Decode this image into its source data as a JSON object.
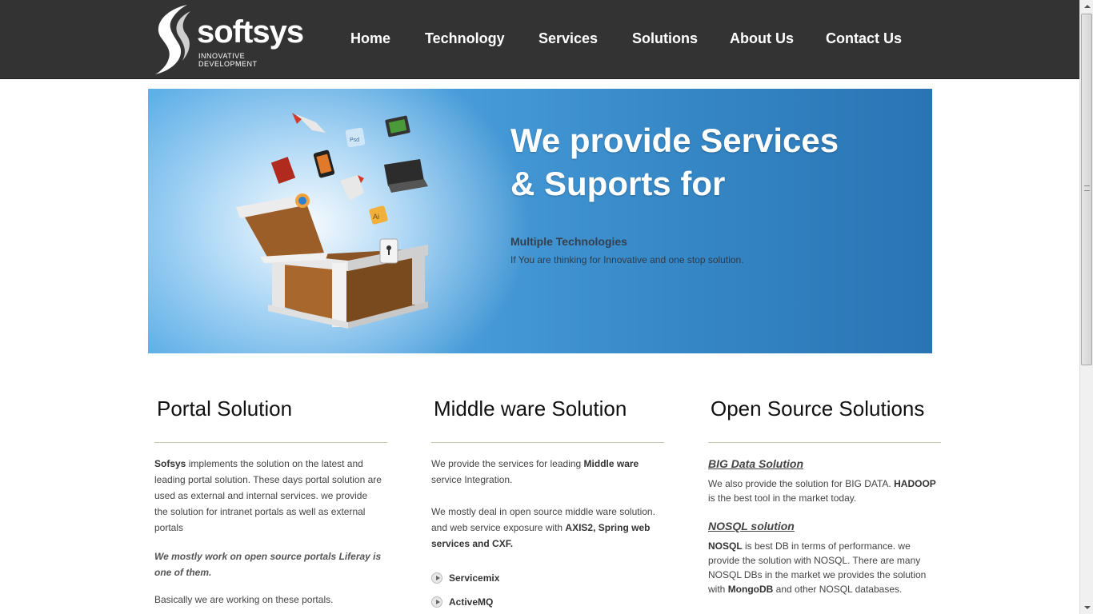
{
  "header": {
    "logo_name": "softsys",
    "logo_tagline": "INNOVATIVE DEVELOPMENT",
    "nav": [
      "Home",
      "Technology",
      "Services",
      "Solutions",
      "About Us",
      "Contact Us"
    ]
  },
  "banner": {
    "title_line1": "We provide Services",
    "title_line2": "& Suports for",
    "subtitle": "Multiple Technologies",
    "description": "If You are thinking for Innovative and one stop solution."
  },
  "columns": {
    "portal": {
      "title": "Portal Solution",
      "p1_strong": "Sofsys",
      "p1_text": " implements the solution on the latest and leading portal solution. These days portal solution are used as external and internal services. we provide the solution for intranet portals as well as external portals",
      "p2_em": "We mostly work on open source portals Liferay is one of them.",
      "p3": "Basically we are working on these portals."
    },
    "middleware": {
      "title": "Middle ware Solution",
      "p1_text": "We provide the services for leading ",
      "p1_strong": "Middle ware",
      "p1_tail": " service Integration.",
      "p2_text": "We mostly deal in open source middle ware solution. and web service exposure with ",
      "p2_strong": "AXIS2, Spring web services and CXF.",
      "bullets": [
        "Servicemix",
        "ActiveMQ"
      ]
    },
    "opensource": {
      "title": "Open Source Solutions",
      "link1": "BIG Data Solution",
      "p1_text": "We also provide the solution for BIG DATA. ",
      "p1_strong": "HADOOP",
      "p1_tail": " is the best tool in the market today.",
      "link2": "NOSQL solution",
      "p2_strong": "NOSQL",
      "p2_text": " is best DB in terms of performance. we provide the solution with NOSQL. There are many NOSQL DBs in the market we provides the solution with ",
      "p2_strong2": "MongoDB",
      "p2_tail": " and other NOSQL databases."
    }
  },
  "colors": {
    "header_bg": "#333333",
    "banner_blue": "#3789c7",
    "text": "#444444"
  }
}
